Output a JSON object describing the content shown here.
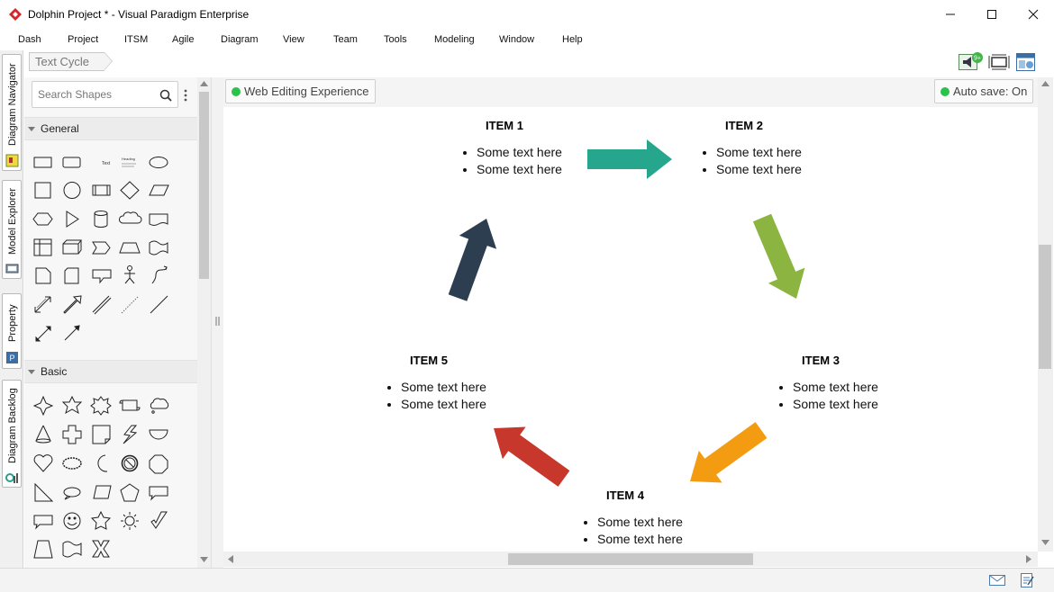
{
  "window": {
    "title": "Dolphin Project * - Visual Paradigm Enterprise",
    "controls": [
      "minimize-icon",
      "maximize-icon",
      "close-icon"
    ]
  },
  "menu": {
    "items": [
      "Dash",
      "Project",
      "ITSM",
      "Agile",
      "Diagram",
      "View",
      "Team",
      "Tools",
      "Modeling",
      "Window",
      "Help"
    ]
  },
  "breadcrumb": {
    "label": "Text Cycle"
  },
  "toolbar": {
    "icons": [
      "announcement-icon",
      "fit-diagram-icon",
      "layout-icon"
    ],
    "notification_badge": "9+"
  },
  "left_tabs": [
    {
      "label": "Diagram Navigator",
      "icon": "navigator-icon"
    },
    {
      "label": "Model Explorer",
      "icon": "model-explorer-icon"
    },
    {
      "label": "Property",
      "icon": "property-icon"
    },
    {
      "label": "Diagram Backlog",
      "icon": "backlog-icon"
    }
  ],
  "palette": {
    "search_placeholder": "Search Shapes",
    "sections": [
      {
        "label": "General"
      },
      {
        "label": "Basic"
      }
    ],
    "general_shapes": [
      "rectangle",
      "rounded-rectangle",
      "text",
      "heading-text",
      "ellipse",
      "square",
      "circle",
      "process",
      "diamond",
      "parallelogram",
      "hexagon",
      "triangle",
      "cylinder",
      "cloud",
      "document",
      "table",
      "cube",
      "chevron",
      "trapezoid",
      "wave",
      "page",
      "rounded-page",
      "callout",
      "stick-figure",
      "s-curve",
      "double-arrow",
      "thick-arrow",
      "double-line",
      "dashed-line",
      "line",
      "connector",
      "arrow"
    ],
    "basic_shapes": [
      "star-4",
      "star-5",
      "burst",
      "scroll",
      "cloud-callout",
      "cone",
      "cross",
      "folded-page",
      "lightning",
      "half-circle",
      "heart",
      "wavy-oval",
      "moon",
      "no-symbol",
      "octagon",
      "right-triangle",
      "oval-callout",
      "slanted-rect",
      "pentagon",
      "rect-callout",
      "round-callout",
      "smiley",
      "star",
      "sun",
      "check",
      "trapezoid",
      "wave-flag",
      "x-shape"
    ]
  },
  "canvas": {
    "status_left": "Web Editing Experience",
    "status_right": "Auto save: On",
    "items": [
      {
        "title": "ITEM 1",
        "bullets": [
          "Some text here",
          "Some text here"
        ]
      },
      {
        "title": "ITEM 2",
        "bullets": [
          "Some text here",
          "Some text here"
        ]
      },
      {
        "title": "ITEM 3",
        "bullets": [
          "Some text here",
          "Some text here"
        ]
      },
      {
        "title": "ITEM 4",
        "bullets": [
          "Some text here",
          "Some text here"
        ]
      },
      {
        "title": "ITEM 5",
        "bullets": [
          "Some text here",
          "Some text here"
        ]
      }
    ],
    "arrow_colors": [
      "#26a68c",
      "#8bb441",
      "#f39c12",
      "#c7372b",
      "#2c3e50"
    ]
  },
  "statusbar": {
    "icons": [
      "mail-icon",
      "edit-note-icon"
    ]
  }
}
